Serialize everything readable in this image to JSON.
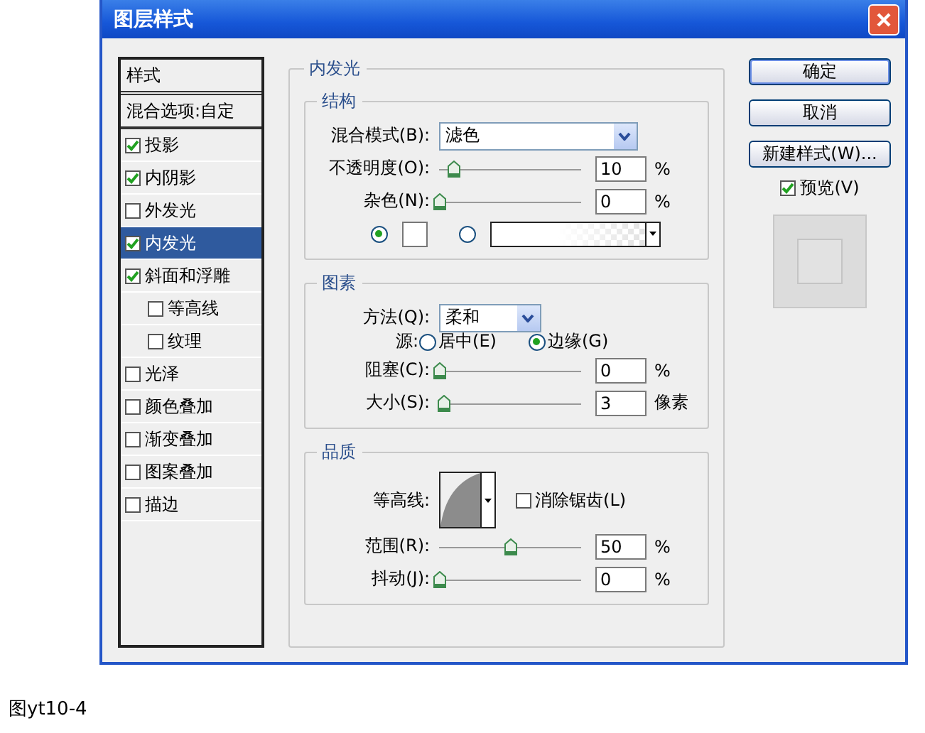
{
  "window": {
    "title": "图层样式"
  },
  "styles_list": {
    "header": "样式",
    "items": [
      {
        "label": "混合选项:自定",
        "kind": "plain",
        "selected": false
      },
      {
        "label": "投影",
        "kind": "check",
        "checked": true,
        "selected": false
      },
      {
        "label": "内阴影",
        "kind": "check",
        "checked": true,
        "selected": false
      },
      {
        "label": "外发光",
        "kind": "check",
        "checked": false,
        "selected": false
      },
      {
        "label": "内发光",
        "kind": "check",
        "checked": true,
        "selected": true
      },
      {
        "label": "斜面和浮雕",
        "kind": "check",
        "checked": true,
        "selected": false,
        "children": [
          {
            "label": "等高线",
            "kind": "check",
            "checked": false,
            "selected": false
          },
          {
            "label": "纹理",
            "kind": "check",
            "checked": false,
            "selected": false
          }
        ]
      },
      {
        "label": "光泽",
        "kind": "check",
        "checked": false,
        "selected": false
      },
      {
        "label": "颜色叠加",
        "kind": "check",
        "checked": false,
        "selected": false
      },
      {
        "label": "渐变叠加",
        "kind": "check",
        "checked": false,
        "selected": false
      },
      {
        "label": "图案叠加",
        "kind": "check",
        "checked": false,
        "selected": false
      },
      {
        "label": "描边",
        "kind": "check",
        "checked": false,
        "selected": false
      }
    ]
  },
  "panel": {
    "title": "内发光",
    "structure": {
      "title": "结构",
      "blend_mode": {
        "label": "混合模式(B):",
        "value": "滤色"
      },
      "opacity": {
        "label": "不透明度(O):",
        "level": 0.1,
        "value": "10",
        "unit": "%"
      },
      "noise": {
        "label": "杂色(N):",
        "level": 0,
        "value": "0",
        "unit": "%"
      },
      "color_options": [
        {
          "kind": "swatch",
          "selected": true
        },
        {
          "kind": "gradient",
          "selected": false
        }
      ]
    },
    "elements": {
      "title": "图素",
      "technique": {
        "label": "方法(Q):",
        "value": "柔和"
      },
      "source": {
        "label": "源:",
        "options": [
          {
            "label": "居中(E)",
            "selected": false
          },
          {
            "label": "边缘(G)",
            "selected": true
          }
        ]
      },
      "choke": {
        "label": "阻塞(C):",
        "level": 0,
        "value": "0",
        "unit": "%"
      },
      "size": {
        "label": "大小(S):",
        "level": 0.03,
        "value": "3",
        "unit": "像素"
      }
    },
    "quality": {
      "title": "品质",
      "contour": {
        "label": "等高线:"
      },
      "anti_alias": {
        "label": "消除锯齿(L)",
        "checked": false
      },
      "range": {
        "label": "范围(R):",
        "level": 0.5,
        "value": "50",
        "unit": "%"
      },
      "jitter": {
        "label": "抖动(J):",
        "level": 0,
        "value": "0",
        "unit": "%"
      }
    }
  },
  "buttons": [
    {
      "label": "确定",
      "default": true
    },
    {
      "label": "取消",
      "default": false
    },
    {
      "label": "新建样式(W)...",
      "default": false
    }
  ],
  "preview": {
    "label": "预览(V)",
    "checked": true
  },
  "caption": "图yt10-4"
}
